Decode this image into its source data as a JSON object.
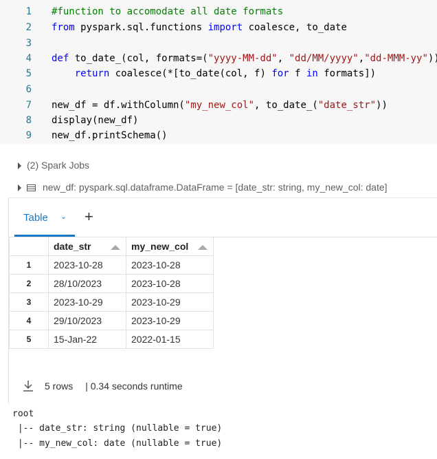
{
  "code": {
    "line_numbers": [
      "1",
      "2",
      "3",
      "4",
      "5",
      "6",
      "7",
      "8",
      "9"
    ],
    "l1_comment": "#function to accomodate all date formats",
    "l2_kw_from": "from",
    "l2_mod": " pyspark.sql.functions ",
    "l2_kw_import": "import",
    "l2_rest": " coalesce, to_date",
    "l4_kw_def": "def",
    "l4_a": " to_date_(col, formats=(",
    "l4_s1": "\"yyyy-MM-dd\"",
    "l4_b": ", ",
    "l4_s2": "\"dd/MM/yyyy\"",
    "l4_c": ",",
    "l4_s3": "\"dd-MMM-yy\"",
    "l4_d": ")):",
    "l5_indent": "    ",
    "l5_kw_return": "return",
    "l5_a": " coalesce(*[to_date(col, f) ",
    "l5_kw_for": "for",
    "l5_b": " f ",
    "l5_kw_in": "in",
    "l5_c": " formats])",
    "l7_a": "new_df = df.withColumn(",
    "l7_s1": "\"my_new_col\"",
    "l7_b": ", to_date_(",
    "l7_s2": "\"date_str\"",
    "l7_c": "))",
    "l8": "display(new_df)",
    "l9": "new_df.printSchema()"
  },
  "spark_jobs": "(2) Spark Jobs",
  "df_info": "new_df:  pyspark.sql.dataframe.DataFrame = [date_str: string, my_new_col: date]",
  "tabs": {
    "table_label": "Table",
    "add_label": "+"
  },
  "table": {
    "columns": [
      "date_str",
      "my_new_col"
    ],
    "rows": [
      {
        "idx": "1",
        "date_str": "2023-10-28",
        "my_new_col": "2023-10-28"
      },
      {
        "idx": "2",
        "date_str": "28/10/2023",
        "my_new_col": "2023-10-28"
      },
      {
        "idx": "3",
        "date_str": "2023-10-29",
        "my_new_col": "2023-10-29"
      },
      {
        "idx": "4",
        "date_str": "29/10/2023",
        "my_new_col": "2023-10-29"
      },
      {
        "idx": "5",
        "date_str": "15-Jan-22",
        "my_new_col": "2022-01-15"
      }
    ]
  },
  "footer": {
    "rows": "5 rows",
    "runtime": "|  0.34 seconds runtime"
  },
  "schema": {
    "root": "root",
    "line1": " |-- date_str: string (nullable = true)",
    "line2": " |-- my_new_col: date (nullable = true)"
  }
}
